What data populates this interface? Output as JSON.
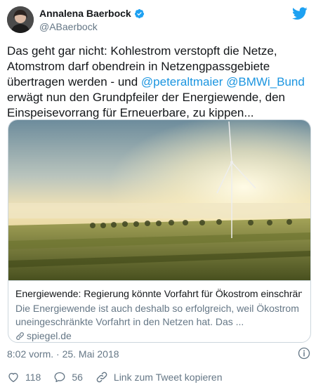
{
  "author": {
    "display_name": "Annalena Baerbock",
    "handle": "@ABaerbock",
    "verified_icon": "verified-badge-icon",
    "avatar_icon": "avatar"
  },
  "tweet": {
    "text_1": "Das geht gar nicht: Kohlestrom verstopft die Netze, Atomstrom darf obendrein in Netzengpassgebiete übertragen werden - und ",
    "mention_1": "@peteraltmaier",
    "text_2": " ",
    "mention_2": "@BMWi_Bund",
    "text_3": " erwägt nun den Grundpfeiler der Energiewende, den Einspeisevorrang für Erneuerbare, zu kippen..."
  },
  "card": {
    "title": "Energiewende: Regierung könnte Vorfahrt für Ökostrom einschränken",
    "description": "Die Energiewende ist auch deshalb so erfolgreich, weil Ökostrom uneingeschränkte Vorfahrt in den Netzen hat. Das ...",
    "domain": "spiegel.de",
    "image": "wind-turbine-landscape-photo"
  },
  "meta": {
    "timestamp": "8:02 vorm. · 25. Mai 2018"
  },
  "actions": {
    "likes": "118",
    "replies": "56",
    "copy_link_label": "Link zum Tweet kopieren"
  },
  "colors": {
    "link": "#1b95e0",
    "secondary": "#657786",
    "twitter_blue": "#1da1f2",
    "border": "#ccd6dd"
  }
}
